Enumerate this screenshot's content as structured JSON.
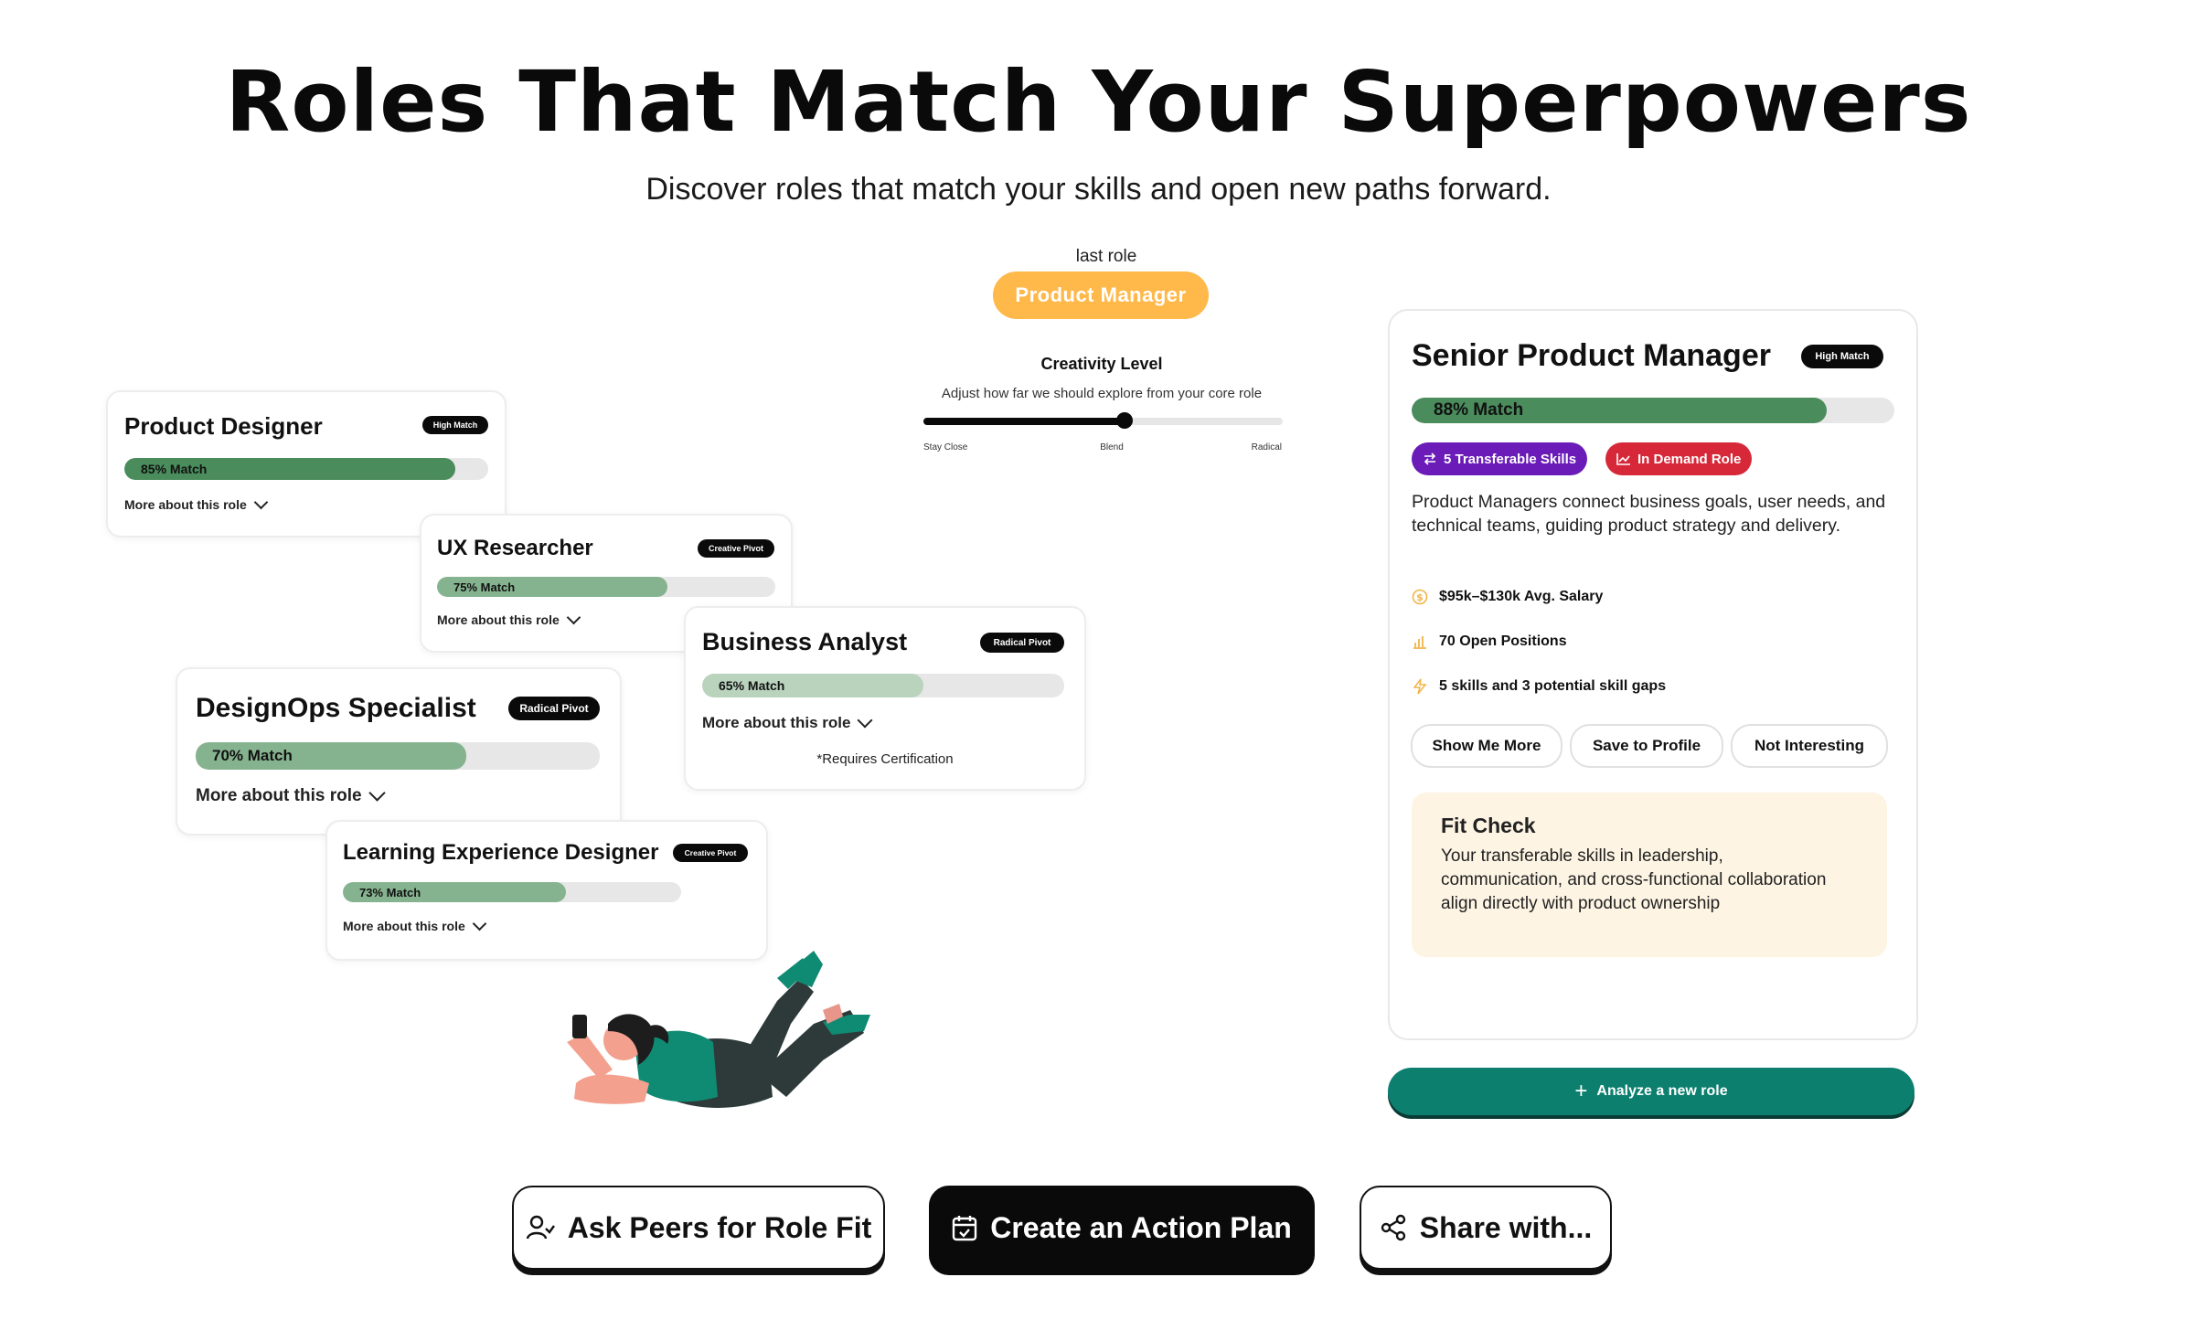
{
  "header": {
    "title": "Roles That Match Your Superpowers",
    "subtitle": "Discover roles that match your skills and open new paths forward."
  },
  "last_role": {
    "label": "last role",
    "value": "Product Manager",
    "color": "#ffb84a"
  },
  "creativity": {
    "title": "Creativity Level",
    "description": "Adjust how far we should explore from your core role",
    "level": 0.56,
    "labels": [
      "Stay Close",
      "Blend",
      "Radical"
    ]
  },
  "role_cards": [
    {
      "title": "Product Designer",
      "badge": "High Match",
      "match_label": "85% Match",
      "match": 85,
      "more": "More about this role"
    },
    {
      "title": "UX Researcher",
      "badge": "Creative Pivot",
      "match_label": "75% Match",
      "match": 75,
      "more": "More about this role"
    },
    {
      "title": "Business Analyst",
      "badge": "Radical Pivot",
      "match_label": "65% Match",
      "match": 65,
      "more": "More about this role",
      "note": "*Requires Certification"
    },
    {
      "title": "DesignOps Specialist",
      "badge": "Radical Pivot",
      "match_label": "70% Match",
      "match": 70,
      "more": "More about this role"
    },
    {
      "title": "Learning Experience Designer",
      "badge": "Creative Pivot",
      "match_label": "73% Match",
      "match": 73,
      "more": "More about this role"
    }
  ],
  "detail": {
    "title": "Senior Product Manager",
    "badge": "High Match",
    "match_label": "88% Match",
    "match": 88,
    "chips": [
      {
        "label": "5 Transferable Skills",
        "icon": "arrows-swap-icon",
        "color": "#6a1bb8"
      },
      {
        "label": "In Demand Role",
        "icon": "trend-chart-icon",
        "color": "#d62839"
      }
    ],
    "description": "Product Managers connect business goals, user needs, and technical teams, guiding product strategy and delivery.",
    "stats": [
      {
        "icon": "dollar-icon",
        "text": "$95k–$130k Avg. Salary"
      },
      {
        "icon": "bar-chart-icon",
        "text": "70 Open Positions"
      },
      {
        "icon": "lightning-icon",
        "text": "5 skills and 3 potential skill gaps"
      }
    ],
    "actions": [
      "Show Me More",
      "Save to Profile",
      "Not Interesting"
    ],
    "fit_check": {
      "title": "Fit Check",
      "text": "Your transferable skills in leadership, communication, and cross-functional collaboration align directly with product ownership"
    },
    "analyze_label": "Analyze a new role"
  },
  "bottom_actions": {
    "ask_peers": "Ask Peers for Role Fit",
    "action_plan": "Create an Action Plan",
    "share": "Share with..."
  },
  "colors": {
    "accent_teal": "#0c7f6f",
    "match_green_dark": "#4a8c5c",
    "match_green_mid": "#86b38f",
    "match_green_light": "#b9d3bd"
  }
}
